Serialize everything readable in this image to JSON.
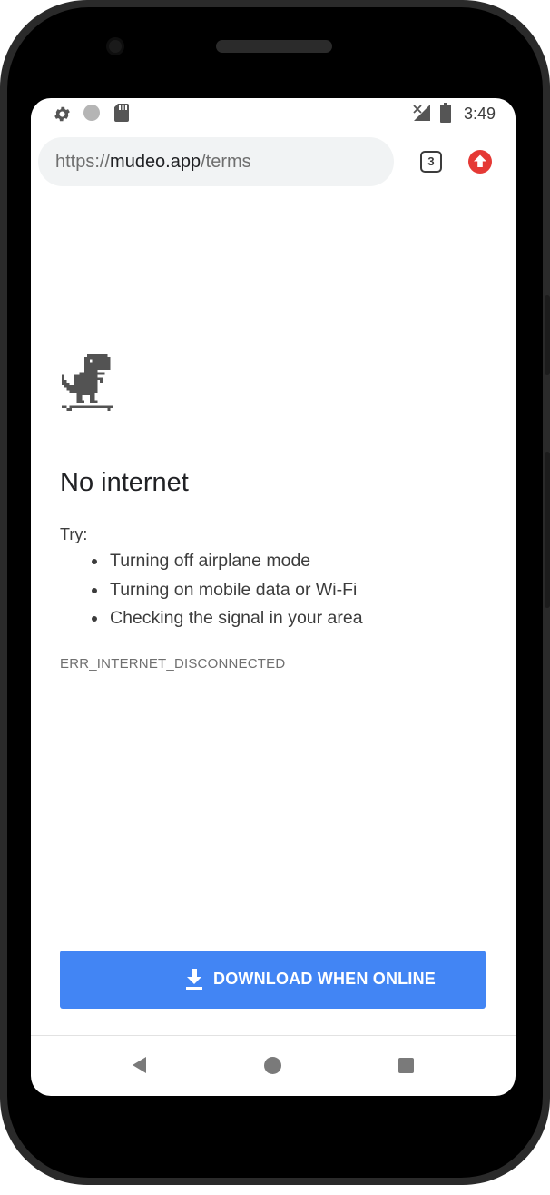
{
  "status_bar": {
    "time": "3:49",
    "icons": [
      "gear-icon",
      "circle-icon",
      "sd-card-icon",
      "no-signal-icon",
      "battery-icon"
    ]
  },
  "browser": {
    "url_scheme": "https://",
    "url_domain": "mudeo.app",
    "url_path": "/terms",
    "tab_count": "3",
    "update_icon": "arrow-up-icon",
    "update_color": "#e53935"
  },
  "page": {
    "heading": "No internet",
    "try_label": "Try:",
    "tips": [
      "Turning off airplane mode",
      "Turning on mobile data or Wi-Fi",
      "Checking the signal in your area"
    ],
    "error_code": "ERR_INTERNET_DISCONNECTED",
    "download_button": "DOWNLOAD WHEN ONLINE",
    "download_color": "#4285f4"
  },
  "nav": {
    "back_icon": "back-triangle-icon",
    "home_icon": "home-circle-icon",
    "recents_icon": "recents-square-icon"
  }
}
